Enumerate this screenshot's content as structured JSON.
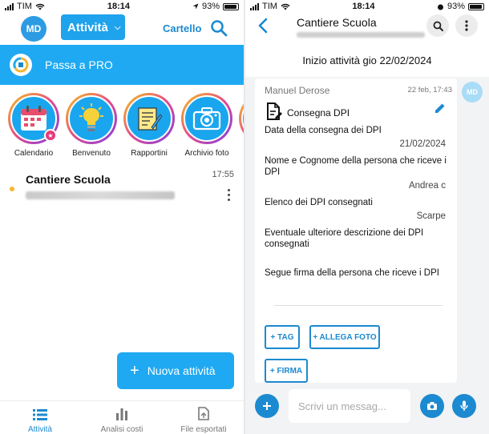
{
  "left": {
    "status": {
      "carrier": "TIM",
      "time": "18:14",
      "battery": "93%"
    },
    "header": {
      "avatar_initials": "MD",
      "dropdown_label": "Attività",
      "cartello": "Cartello"
    },
    "pro_banner": {
      "label": "Passa a PRO"
    },
    "stories": [
      {
        "label": "Calendario"
      },
      {
        "label": "Benvenuto"
      },
      {
        "label": "Rapportini"
      },
      {
        "label": "Archivio foto"
      }
    ],
    "activity": {
      "title": "Cantiere Scuola",
      "time": "17:55"
    },
    "fab": {
      "label": "Nuova attività"
    },
    "tabs": [
      {
        "label": "Attività"
      },
      {
        "label": "Analisi costi"
      },
      {
        "label": "File esportati"
      }
    ]
  },
  "right": {
    "status": {
      "carrier": "TIM",
      "time": "18:14",
      "battery": "93%"
    },
    "header": {
      "title": "Cantiere Scuola"
    },
    "date_banner": "Inizio attività gio 22/02/2024",
    "avatar_initials": "MD",
    "card": {
      "author": "Manuel Derose",
      "time": "22 feb, 17:43",
      "form_title": "Consegna DPI",
      "fields": [
        {
          "question": "Data della consegna dei DPI",
          "answer": "21/02/2024"
        },
        {
          "question": "Nome e Cognome della persona che riceve i DPI",
          "answer": "Andrea c"
        },
        {
          "question": "Elenco dei DPI consegnati",
          "answer": "Scarpe"
        },
        {
          "question": "Eventuale ulteriore descrizione dei DPI consegnati",
          "answer": ""
        },
        {
          "question": "Segue firma della persona che riceve i DPI",
          "answer": ""
        }
      ],
      "chips": {
        "tag": "+ TAG",
        "allega_foto": "+ ALLEGA FOTO",
        "firma": "+ FIRMA"
      }
    },
    "composer": {
      "placeholder": "Scrivi un messag..."
    }
  },
  "colors": {
    "primary": "#1fa9f2",
    "accent_dark": "#1c8ad0",
    "dot": "#f7b531",
    "badge": "#e6397a"
  }
}
